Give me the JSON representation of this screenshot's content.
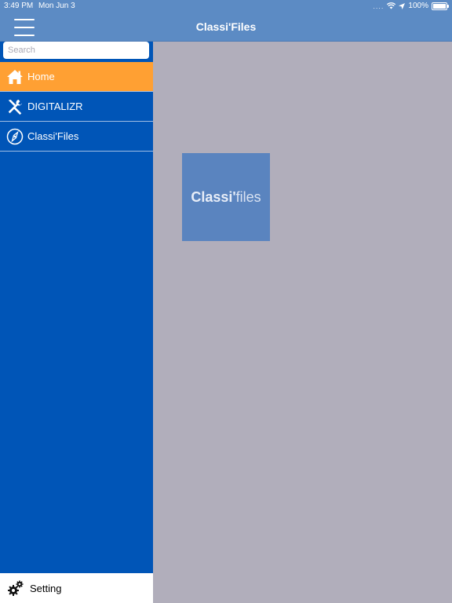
{
  "status_bar": {
    "time": "3:49 PM",
    "date": "Mon Jun 3",
    "signal_dots": "....",
    "battery": "100%"
  },
  "nav_bar": {
    "title": "Classi'Files"
  },
  "sidebar": {
    "search": {
      "placeholder": "Search",
      "value": ""
    },
    "items": [
      {
        "label": "Home",
        "icon": "home-icon",
        "active": true
      },
      {
        "label": "DIGITALIZR",
        "icon": "tools-icon",
        "active": false
      },
      {
        "label": "Classi'Files",
        "icon": "compass-icon",
        "active": false
      }
    ],
    "footer": {
      "label": "Setting",
      "icon": "gears-icon"
    }
  },
  "main": {
    "logo": {
      "bold_part": "Classi'",
      "light_part": "files"
    }
  },
  "colors": {
    "nav": "#5c8bc4",
    "sidebar": "#0055b7",
    "active_item": "#ffa033",
    "content_bg": "#b1aebb",
    "logo_tile": "#5a84bf"
  }
}
